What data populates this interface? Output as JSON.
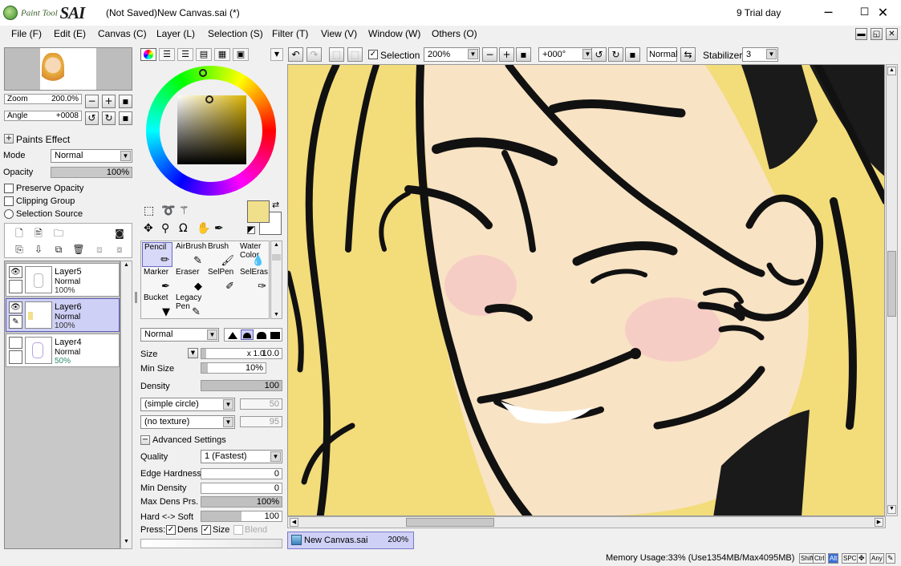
{
  "titlebar": {
    "logo_text_small": "Paint Tool",
    "logo_text_big": "SAI",
    "doc_title": "(Not Saved)New Canvas.sai (*)",
    "trial": "9 Trial day",
    "min_icon": "─",
    "max_icon": "☐",
    "close_icon": "✕"
  },
  "menu": [
    "File (F)",
    "Edit (E)",
    "Canvas (C)",
    "Layer (L)",
    "Selection (S)",
    "Filter (T)",
    "View (V)",
    "Window (W)",
    "Others (O)"
  ],
  "navigator": {
    "zoom_label": "Zoom",
    "zoom_value": "200.0%",
    "angle_label": "Angle",
    "angle_value": "+0008"
  },
  "paint_effect": {
    "header": "Paints Effect",
    "mode_label": "Mode",
    "mode_value": "Normal",
    "opacity_label": "Opacity",
    "opacity_value": "100%",
    "preserve_opacity": "Preserve Opacity",
    "clipping_group": "Clipping Group",
    "selection_source": "Selection Source"
  },
  "layers": [
    {
      "name": "Layer5",
      "mode": "Normal",
      "opacity": "100%",
      "selected": false,
      "visible": true
    },
    {
      "name": "Layer6",
      "mode": "Normal",
      "opacity": "100%",
      "selected": true,
      "visible": true
    },
    {
      "name": "Layer4",
      "mode": "Normal",
      "opacity": "50%",
      "selected": false,
      "visible": false
    }
  ],
  "colors": {
    "primary": "#f1e08b",
    "secondary": "#ffffff",
    "accent_selected": "#cfd0f5",
    "canvas_hair": "#f3dc7a",
    "canvas_skin": "#f8e3c4"
  },
  "tools": [
    {
      "label": "Pencil",
      "icon": "✏",
      "selected": true
    },
    {
      "label": "AirBrush",
      "icon": "✎",
      "selected": false
    },
    {
      "label": "Brush",
      "icon": "🖌",
      "selected": false
    },
    {
      "label": "Water Color",
      "icon": "💧",
      "selected": false
    },
    {
      "label": "Marker",
      "icon": "✒",
      "selected": false
    },
    {
      "label": "Eraser",
      "icon": "◆",
      "selected": false
    },
    {
      "label": "SelPen",
      "icon": "✐",
      "selected": false
    },
    {
      "label": "SelEras",
      "icon": "✑",
      "selected": false
    },
    {
      "label": "Bucket",
      "icon": "▼",
      "selected": false
    },
    {
      "label": "Legacy Pen",
      "icon": "✎",
      "selected": false
    }
  ],
  "brush": {
    "blend_mode": "Normal",
    "size_label": "Size",
    "size_multiplier": "x 1.0",
    "size_value": "10.0",
    "min_size_label": "Min Size",
    "min_size_value": "10%",
    "density_label": "Density",
    "density_value": "100",
    "shape": "(simple circle)",
    "shape_value": "50",
    "texture": "(no texture)",
    "texture_value": "95",
    "advanced_header": "Advanced Settings",
    "quality_label": "Quality",
    "quality_value": "1 (Fastest)",
    "edge_hardness_label": "Edge Hardness",
    "edge_hardness_value": "0",
    "min_density_label": "Min Density",
    "min_density_value": "0",
    "max_dens_label": "Max Dens Prs.",
    "max_dens_value": "100%",
    "hard_soft_label": "Hard <-> Soft",
    "hard_soft_value": "100",
    "press_label": "Press:",
    "press_dens": "Dens",
    "press_size": "Size",
    "press_blend": "Blend"
  },
  "canvas_toolbar": {
    "selection_label": "Selection",
    "zoom": "200%",
    "rotation": "+000°",
    "blend": "Normal",
    "stabilizer_label": "Stabilizer",
    "stabilizer_value": "3"
  },
  "canvas_tab": {
    "name": "New Canvas.sai",
    "zoom": "200%"
  },
  "status": {
    "memory": "Memory Usage:33% (Use1354MB/Max4095MB)",
    "keys": [
      "Shift",
      "Ctrl",
      "Alt",
      "SPC",
      "✥",
      "Any",
      "✎"
    ]
  }
}
